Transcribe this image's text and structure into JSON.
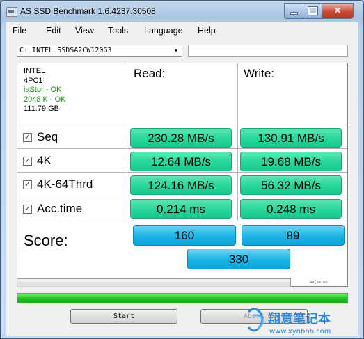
{
  "window": {
    "title": "AS SSD Benchmark 1.6.4237.30508"
  },
  "menu": [
    "File",
    "Edit",
    "View",
    "Tools",
    "Language",
    "Help"
  ],
  "drive": {
    "selected": "C: INTEL SSDSA2CW120G3"
  },
  "info": {
    "vendor": "INTEL",
    "firmware": "4PC1",
    "driver": "iaStor - OK",
    "alignment": "2048 K - OK",
    "size": "111.79 GB"
  },
  "columns": {
    "read": "Read:",
    "write": "Write:"
  },
  "rows": [
    {
      "label": "Seq",
      "checked": true,
      "read": "230.28 MB/s",
      "write": "130.91 MB/s"
    },
    {
      "label": "4K",
      "checked": true,
      "read": "12.64 MB/s",
      "write": "19.68 MB/s"
    },
    {
      "label": "4K-64Thrd",
      "checked": true,
      "read": "124.16 MB/s",
      "write": "56.32 MB/s"
    },
    {
      "label": "Acc.time",
      "checked": true,
      "read": "0.214 ms",
      "write": "0.248 ms"
    }
  ],
  "score": {
    "label": "Score:",
    "read": "160",
    "write": "89",
    "total": "330"
  },
  "status": {
    "time": "--:--:--",
    "progress_pct": 0,
    "overall_pct": 100
  },
  "buttons": {
    "start": "Start",
    "abort": "Abort"
  },
  "watermark": {
    "brand": "翔意笔记本",
    "url": "www.xynbnb.com"
  },
  "colors": {
    "value_bg": "#26d69a",
    "score_bg": "#1ab4e6",
    "progress": "#1fc21f",
    "close_btn": "#c84b35"
  }
}
